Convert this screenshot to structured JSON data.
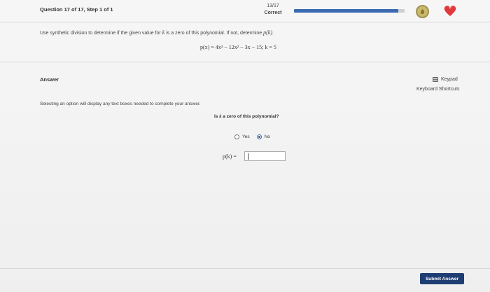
{
  "header": {
    "question_label": "Question 17 of 17, Step 1 of 1",
    "score": "13/17",
    "score_status": "Correct",
    "progress": 0.94,
    "hearts": "0",
    "accent_color": "#3b6ab1",
    "heart_color": "#e0393b"
  },
  "question": {
    "text_before": "Use synthetic division to determine if the given value for ",
    "var_k": "k",
    "text_middle": " is a zero of this polynomial. If not, determine ",
    "var_pk": "p(k)",
    "text_after": ".",
    "equation": "p(x) = 4x³ − 12x² − 3x − 15; k = 5"
  },
  "answer": {
    "label": "Answer",
    "keypad_label": "Keypad",
    "shortcuts_label": "Keyboard Shortcuts",
    "instruction": "Selecting an option will display any text boxes needed to complete your answer.",
    "sub_question_prefix": "Is ",
    "sub_question_var": "k",
    "sub_question_suffix": " a zero of this polynomial?",
    "options": [
      {
        "label": "Yes",
        "selected": false
      },
      {
        "label": "No",
        "selected": true
      }
    ],
    "pk_label": "p(k) =",
    "pk_value": ""
  },
  "footer": {
    "submit_label": "Submit Answer"
  }
}
